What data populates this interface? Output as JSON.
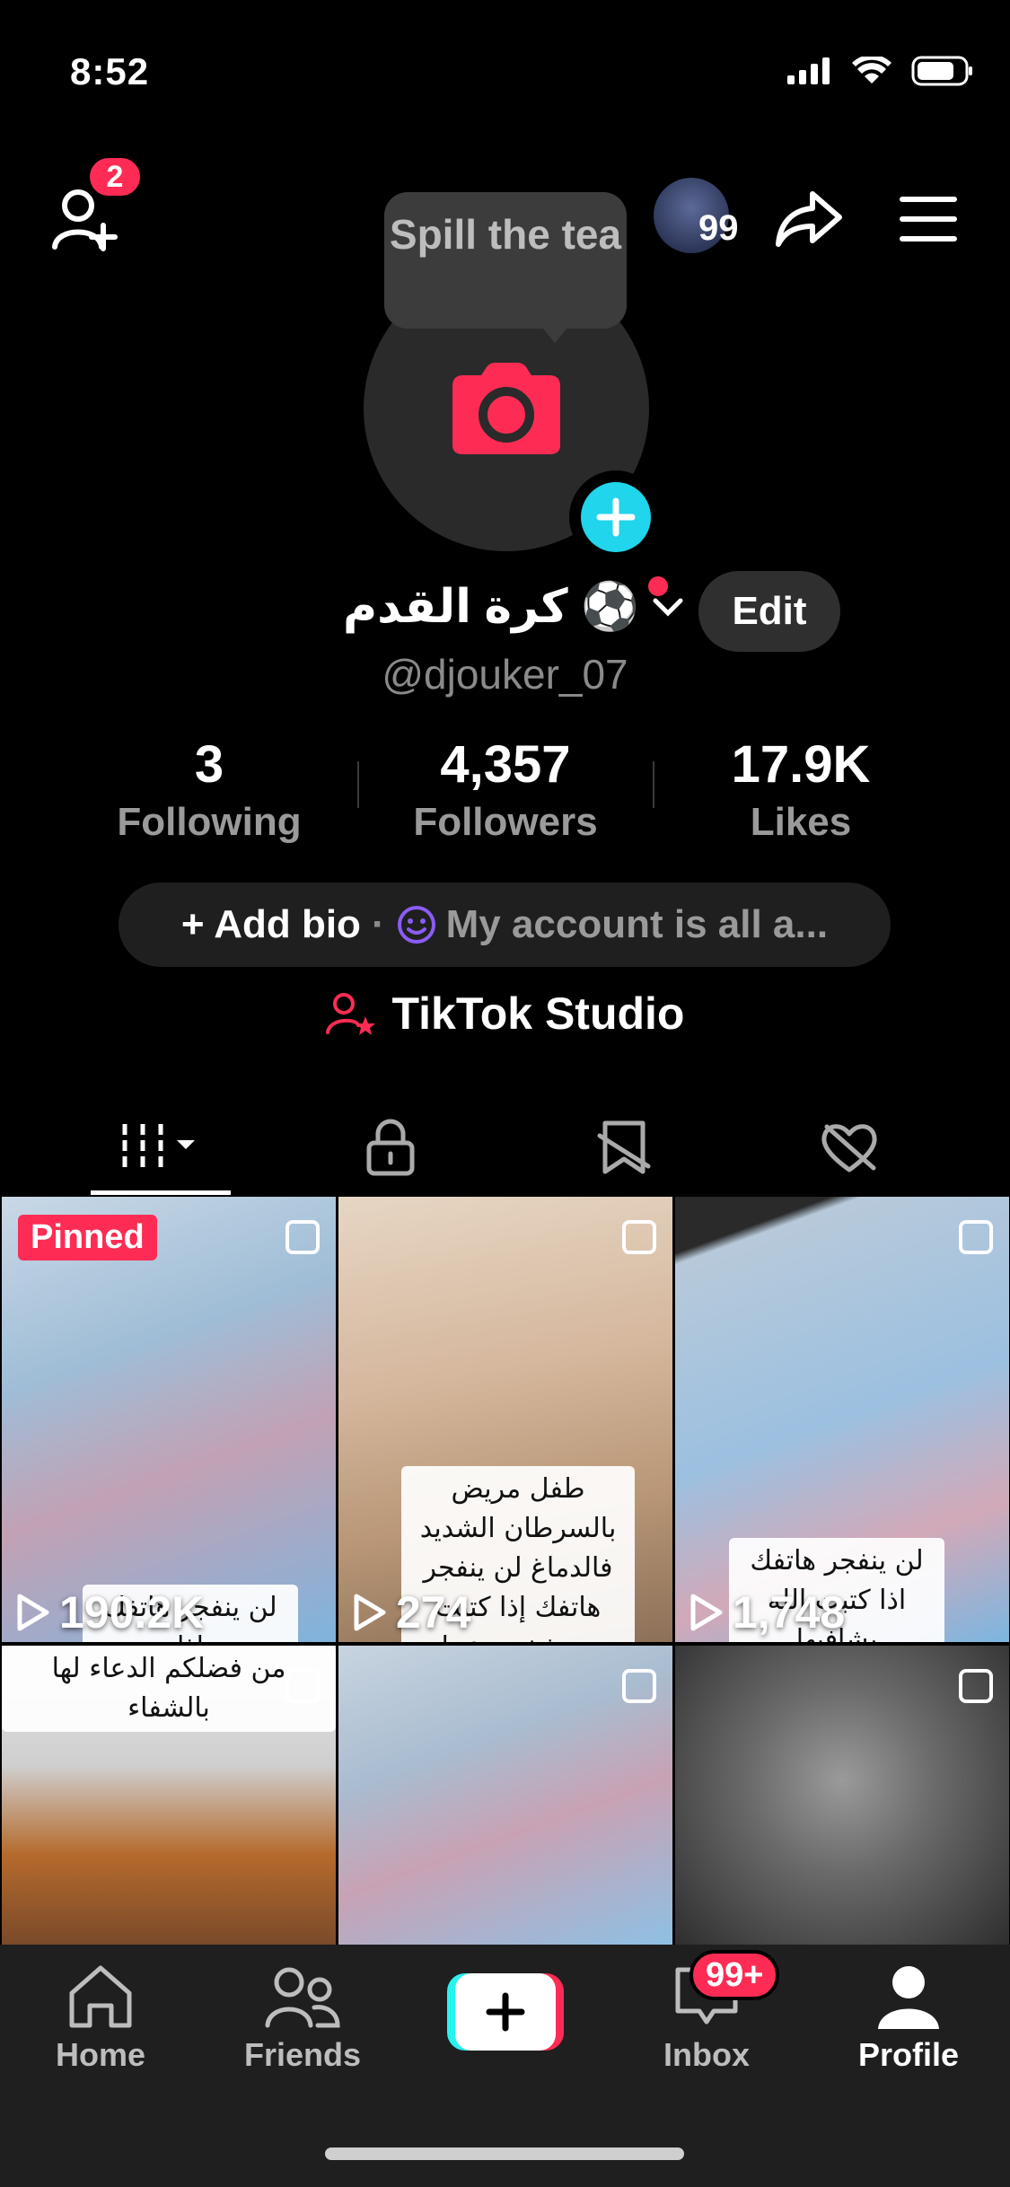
{
  "status_bar": {
    "time": "8:52"
  },
  "header": {
    "friends_badge": "2",
    "avatar_badge": "99"
  },
  "tooltip": {
    "text": "Spill the tea"
  },
  "profile": {
    "name": "كرة القدم ⚽️",
    "handle": "@djouker_07",
    "edit_label": "Edit"
  },
  "stats": [
    {
      "value": "3",
      "label": "Following"
    },
    {
      "value": "4,357",
      "label": "Followers"
    },
    {
      "value": "17.9K",
      "label": "Likes"
    }
  ],
  "bio": {
    "add_label": "+ Add bio",
    "separator": "·",
    "note": "My account is all a..."
  },
  "studio": {
    "label": "TikTok Studio"
  },
  "grid": {
    "pinned_label": "Pinned",
    "videos": [
      {
        "views": "190.2K",
        "caption": "لن ينفجر هاتفك اذا"
      },
      {
        "views": "274",
        "caption": "طفل مريض بالسرطان الشديد فالدماغ لن ينفجر هاتفك إذا كتبت ربي يشفيه وعملت متابعة"
      },
      {
        "views": "1,748",
        "caption": "لن ينفجر هاتفك اذا كتبت الله يشافيها"
      },
      {
        "views": "",
        "caption": "من فضلكم الدعاء لها بالشفاء"
      },
      {
        "views": "",
        "caption": ""
      },
      {
        "views": "",
        "caption": ""
      }
    ]
  },
  "nav": {
    "home": "Home",
    "friends": "Friends",
    "inbox": "Inbox",
    "inbox_badge": "99+",
    "profile": "Profile"
  }
}
